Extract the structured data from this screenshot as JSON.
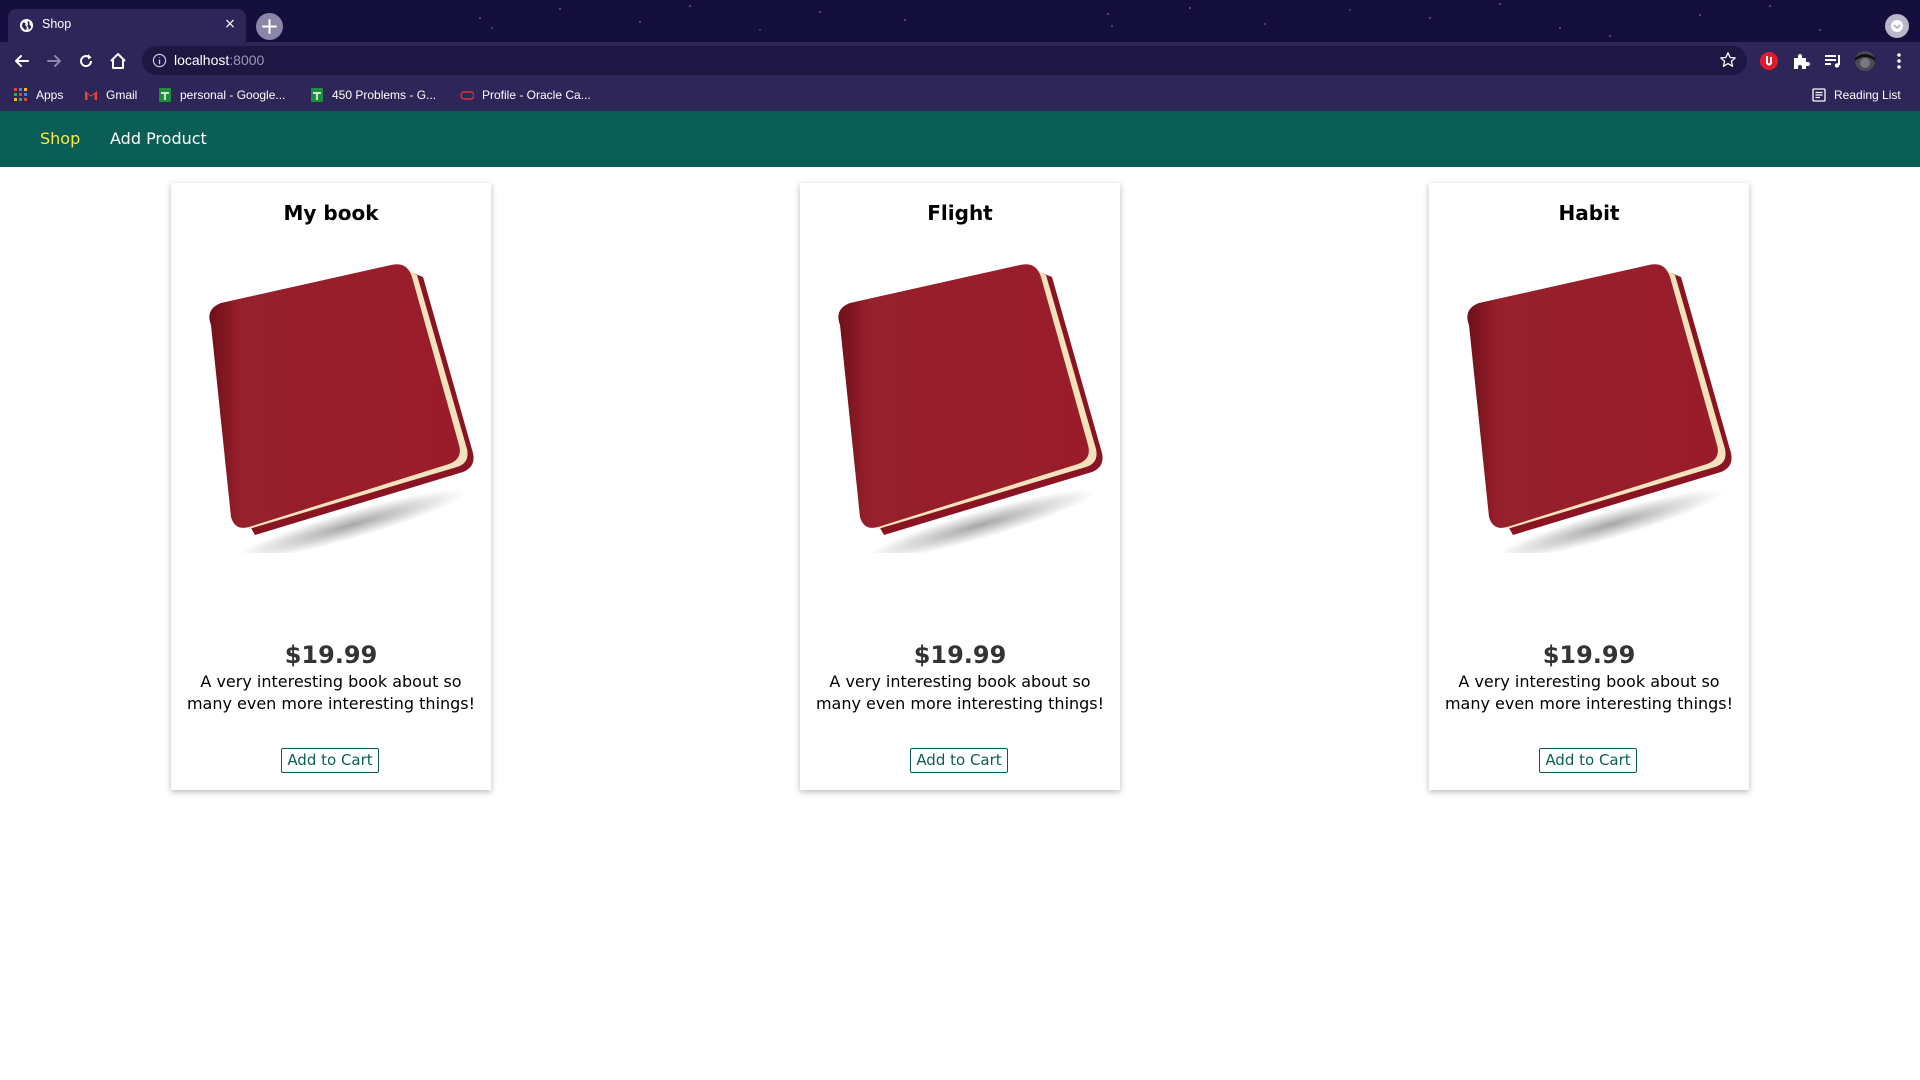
{
  "browser": {
    "tab_title": "Shop",
    "tab_close": "×",
    "url_host": "localhost",
    "url_port": ":8000",
    "bookmarks": [
      {
        "label": "Apps"
      },
      {
        "label": "Gmail"
      },
      {
        "label": "personal - Google..."
      },
      {
        "label": "450 Problems - G..."
      },
      {
        "label": "Profile - Oracle Ca..."
      }
    ],
    "reading_list": "Reading List"
  },
  "nav": {
    "shop": "Shop",
    "add_product": "Add Product",
    "active_color": "#ffeb3b",
    "bar_color": "#0b5e55"
  },
  "products": [
    {
      "title": "My book",
      "price": "$19.99",
      "description": "A very interesting book about so many even more interesting things!",
      "button": "Add to Cart"
    },
    {
      "title": "Flight",
      "price": "$19.99",
      "description": "A very interesting book about so many even more interesting things!",
      "button": "Add to Cart"
    },
    {
      "title": "Habit",
      "price": "$19.99",
      "description": "A very interesting book about so many even more interesting things!",
      "button": "Add to Cart"
    }
  ]
}
